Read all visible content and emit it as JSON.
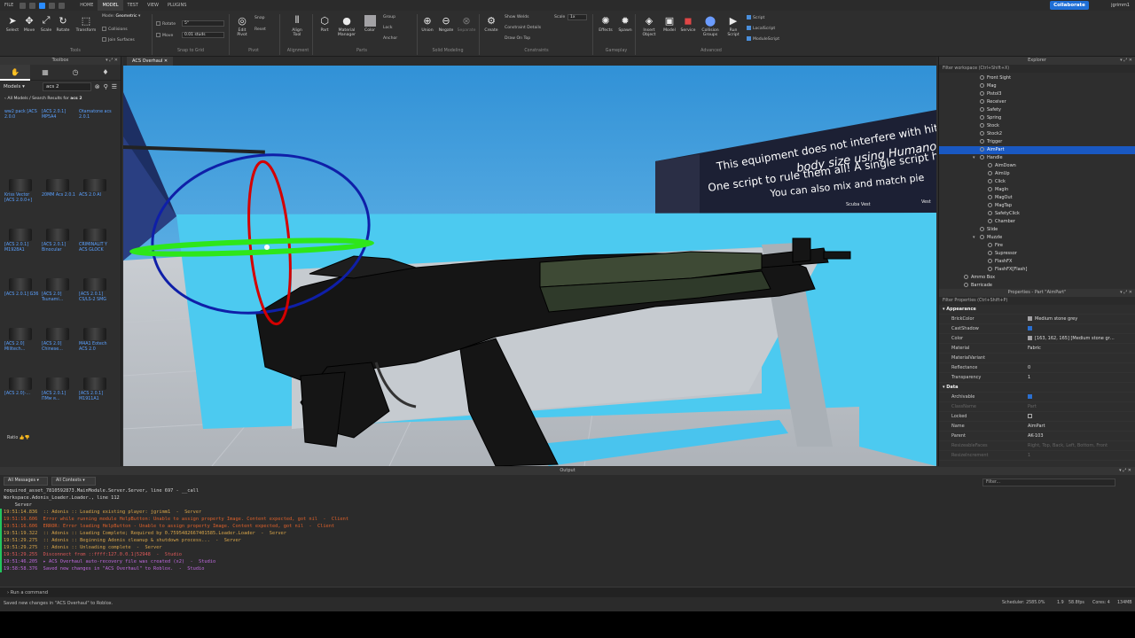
{
  "menu": {
    "file": "FILE",
    "tabs": [
      "HOME",
      "MODEL",
      "TEST",
      "VIEW",
      "PLUGINS"
    ],
    "active": "MODEL",
    "collaborate": "Collaborate",
    "user": "jgrimm1"
  },
  "ribbon": {
    "tools": [
      "Select",
      "Move",
      "Scale",
      "Rotate",
      "Transform"
    ],
    "tools_section": "Tools",
    "mode_label": "Mode:",
    "mode_value": "Geometric",
    "collisions": "Collisions",
    "join_surfaces": "Join Surfaces",
    "rotate_label": "Rotate",
    "rotate_value": "5°",
    "move_label": "Move",
    "move_value": "0.01 studs",
    "snap_section": "Snap to Grid",
    "edit_pivot": "Edit Pivot",
    "snap": "Snap",
    "reset": "Reset",
    "pivot_section": "Pivot",
    "align_tool": "Align Tool",
    "alignment_section": "Alignment",
    "part": "Part",
    "material_manager": "Material Manager",
    "color": "Color",
    "group": "Group",
    "lock": "Lock",
    "anchor": "Anchor",
    "parts_section": "Parts",
    "union": "Union",
    "negate": "Negate",
    "separate": "Separate",
    "solid_section": "Solid Modeling",
    "create": "Create",
    "show_welds": "Show Welds",
    "constraint_details": "Constraint Details",
    "draw_on_top": "Draw On Top",
    "scale_label": "Scale",
    "scale_value": "1x",
    "constraints_section": "Constraints",
    "effects": "Effects",
    "spawn": "Spawn",
    "gameplay_section": "Gameplay",
    "insert_object": "Insert Object",
    "model": "Model",
    "service": "Service",
    "collision_groups": "Collision Groups",
    "run_script": "Run Script",
    "script": "Script",
    "local_script": "LocalScript",
    "module_script": "ModuleScript",
    "advanced_section": "Advanced"
  },
  "toolbox": {
    "title": "Toolbox",
    "category": "Models",
    "search": "acs 2",
    "breadcrumb_prefix": "All Models / Search Results for ",
    "breadcrumb_query": "acs 2",
    "items": [
      "ww2 pack [ACS 2.0.0",
      "[ACS 2.0.1] MP5A4",
      "Otamatone acs 2.0.1",
      "Kriss Vector [ACS 2.0.0+]",
      "20MM Acs 2.0.1",
      "ACS 2.0 AI",
      "[ACS 2.0.1] M1928A1",
      "[ACS 2.0.1] Binocular",
      "CRIMINALIT Y ACS GLOCK",
      "[ACS 2.0.1] G36",
      "[ACS 2.0] Tsunami…",
      "[ACS 2.0.1] CS/LS-2 SMG",
      "[ACS 2.0] Militech…",
      "[ACS 2.0] Chinese…",
      "M4A1 Eotech ACS 2.0",
      "[ACS 2.0]-…",
      "[ACS 2.0.1] ПМм я…",
      "[ACS 2.0.1] M1911A1"
    ],
    "ratio_label": "Ratio"
  },
  "viewport": {
    "tab": "ACS Overhaul",
    "billboard_lines": [
      "This equipment does not interfere with hit registrat",
      "body size using Humanoid Sca",
      "One script to rule them all! A single script handles",
      "You can also mix and match pie"
    ],
    "billboard_small": "This equipment does not interfere with hit registration",
    "sign_left": "Scuba Vest",
    "sign_right": "Vest"
  },
  "explorer": {
    "title": "Explorer",
    "filter": "Filter workspace (Ctrl+Shift+X)",
    "items": [
      {
        "label": "Front Sight",
        "indent": 4
      },
      {
        "label": "Mag",
        "indent": 4
      },
      {
        "label": "Pistol3",
        "indent": 4
      },
      {
        "label": "Receiver",
        "indent": 4
      },
      {
        "label": "Safety",
        "indent": 4
      },
      {
        "label": "Spring",
        "indent": 4
      },
      {
        "label": "Stock",
        "indent": 4
      },
      {
        "label": "Stock2",
        "indent": 4
      },
      {
        "label": "Trigger",
        "indent": 4
      },
      {
        "label": "AimPart",
        "indent": 4,
        "selected": true
      },
      {
        "label": "Handle",
        "indent": 4,
        "open": true
      },
      {
        "label": "AimDown",
        "indent": 5
      },
      {
        "label": "AimUp",
        "indent": 5
      },
      {
        "label": "Click",
        "indent": 5
      },
      {
        "label": "MagIn",
        "indent": 5
      },
      {
        "label": "MagOut",
        "indent": 5
      },
      {
        "label": "MagTap",
        "indent": 5
      },
      {
        "label": "SafetyClick",
        "indent": 5
      },
      {
        "label": "Chamber",
        "indent": 5
      },
      {
        "label": "Slide",
        "indent": 4
      },
      {
        "label": "Muzzle",
        "indent": 4,
        "open": true
      },
      {
        "label": "Fire",
        "indent": 5
      },
      {
        "label": "Supressor",
        "indent": 5
      },
      {
        "label": "FlashFX",
        "indent": 5
      },
      {
        "label": "FlashFX[Flash]",
        "indent": 5
      },
      {
        "label": "Ammo Box",
        "indent": 2
      },
      {
        "label": "Barricade",
        "indent": 2
      }
    ]
  },
  "properties": {
    "title": "Properties - Part \"AimPart\"",
    "filter": "Filter Properties (Ctrl+Shift+P)",
    "rows": [
      {
        "cat": "Appearance"
      },
      {
        "name": "BrickColor",
        "value": "Medium stone grey",
        "swatch": true
      },
      {
        "name": "CastShadow",
        "value": "",
        "check": true
      },
      {
        "name": "Color",
        "value": "[163, 162, 165] [Medium stone gr…",
        "swatch": true
      },
      {
        "name": "Material",
        "value": "Fabric"
      },
      {
        "name": "MaterialVariant",
        "value": ""
      },
      {
        "name": "Reflectance",
        "value": "0"
      },
      {
        "name": "Transparency",
        "value": "1"
      },
      {
        "cat": "Data"
      },
      {
        "name": "Archivable",
        "value": "",
        "check": true
      },
      {
        "name": "ClassName",
        "value": "Part",
        "dim": true
      },
      {
        "name": "Locked",
        "value": "",
        "box": true
      },
      {
        "name": "Name",
        "value": "AimPart"
      },
      {
        "name": "Parent",
        "value": "AK-103"
      },
      {
        "name": "ResizeableFaces",
        "value": "Right, Top, Back, Left, Bottom, Front",
        "dim": true
      },
      {
        "name": "ResizeIncrement",
        "value": "1",
        "dim": true
      }
    ]
  },
  "output": {
    "title": "Output",
    "filter_all_messages": "All Messages",
    "filter_all_contexts": "All Contexts",
    "filter_placeholder": "Filter...",
    "lines": [
      {
        "t": "required_asset_7810592873.MainModule.Server.Server, line 697 - __call",
        "c": "#d6d6d6",
        "bar": false
      },
      {
        "t": "Workspace.Adonis_Loader.Loader., line 112",
        "c": "#d6d6d6",
        "bar": false
      },
      {
        "t": "    Server",
        "c": "#d6d6d6",
        "bar": false
      },
      {
        "t": "19:51:14.836  :: Adonis :: Loading existing player: jgrimm1  -  Server",
        "c": "#d9a64a",
        "bar": true
      },
      {
        "t": "19:51:16.606  Error while running module HelpButton: Unable to assign property Image. Content expected, got nil  -  Client",
        "c": "#e0612a",
        "bar": true
      },
      {
        "t": "19:51:16.606  ERROR: Error loading HelpButton - Unable to assign property Image. Content expected, got nil  -  Client",
        "c": "#e0612a",
        "bar": true
      },
      {
        "t": "19:51:19.322  :: Adonis :: Loading Complete; Required by 0.7595482667401585.Loader.Loader  -  Server",
        "c": "#d9a64a",
        "bar": true
      },
      {
        "t": "19:51:29.275  :: Adonis :: Beginning Adonis cleanup & shutdown process...  -  Server",
        "c": "#d9a64a",
        "bar": true
      },
      {
        "t": "19:51:29.275  :: Adonis :: Unloading complete  -  Server",
        "c": "#d9a64a",
        "bar": true
      },
      {
        "t": "19:51:29.255  Disconnect from ::ffff:127.0.0.1|52948  -  Studio",
        "c": "#e05a5a",
        "bar": true
      },
      {
        "t": "19:51:46.205  ▸ ACS Overhaul auto-recovery file was created (x2)  -  Studio",
        "c": "#c06ae0",
        "bar": true
      },
      {
        "t": "19:58:58.376  Saved new changes in \"ACS Overhaul\" to Roblox.  -  Studio",
        "c": "#c06ae0",
        "bar": true
      }
    ]
  },
  "command_bar": "Run a command",
  "status": {
    "left": "Saved new changes in \"ACS Overhaul\" to Roblox.",
    "sched": "Scheduler: 2585.0%",
    "a": "1.9",
    "b": "58.8fps",
    "c": "Cores: 4",
    "d": "134MB"
  }
}
